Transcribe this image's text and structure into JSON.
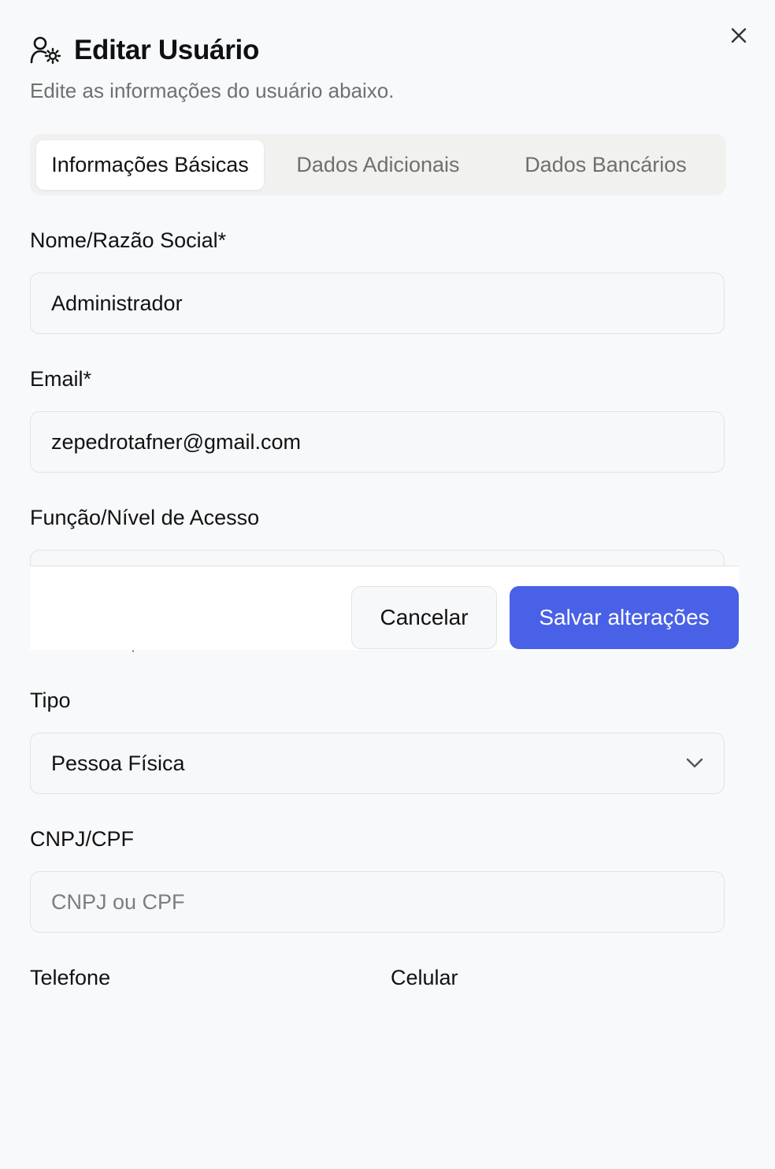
{
  "dialog": {
    "title": "Editar Usuário",
    "subtitle": "Edite as informações do usuário abaixo.",
    "close_icon": "x-icon",
    "title_icon": "user-gear-icon"
  },
  "tabs": [
    {
      "label": "Informações Básicas",
      "active": true
    },
    {
      "label": "Dados Adicionais",
      "active": false
    },
    {
      "label": "Dados Bancários",
      "active": false
    }
  ],
  "form": {
    "nome": {
      "label": "Nome/Razão Social*",
      "value": "Administrador"
    },
    "email": {
      "label": "Email*",
      "value": "zepedrotafner@gmail.com"
    },
    "funcao": {
      "label": "Função/Nível de Acesso"
    },
    "tipo": {
      "label": "Tipo",
      "value": "Pessoa Física"
    },
    "cnpj": {
      "label": "CNPJ/CPF",
      "placeholder": "CNPJ ou CPF"
    },
    "telefone": {
      "label": "Telefone"
    },
    "celular": {
      "label": "Celular"
    }
  },
  "footer": {
    "cancel_label": "Cancelar",
    "save_label": "Salvar alterações"
  },
  "colors": {
    "primary": "#4861e6",
    "background": "#f8f9fb",
    "muted_text": "#707070"
  }
}
